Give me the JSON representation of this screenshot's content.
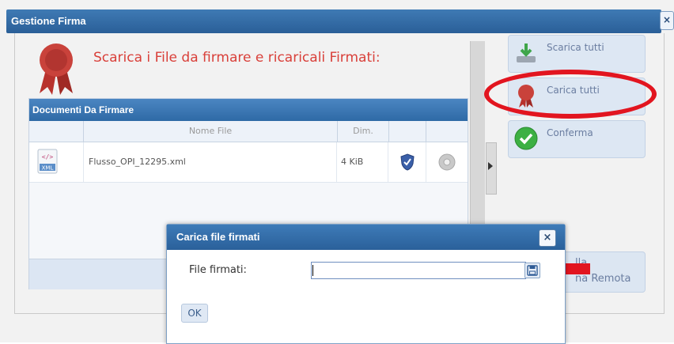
{
  "window": {
    "title": "Gestione Firma",
    "close_symbol": "×"
  },
  "heading": "Scarica i File da firmare e ricaricali Firmati:",
  "grid": {
    "title": "Documenti Da Firmare",
    "columns": [
      "",
      "Nome File",
      "Dim.",
      "",
      ""
    ],
    "rows": [
      {
        "icon": "xml-file-icon",
        "icon_text": "XML",
        "name": "Flusso_OPI_12295.xml",
        "size": "4 KiB"
      }
    ]
  },
  "actions": {
    "scarica_tutti": "Scarica tutti",
    "carica_tutti": "Carica tutti",
    "conferma": "Conferma",
    "partial_line1": "lla",
    "partial_line2": "na Remota"
  },
  "dialog": {
    "title": "Carica file firmati",
    "close_symbol": "×",
    "field_label": "File firmati:",
    "field_value": "",
    "ok_label": "OK"
  },
  "colors": {
    "accent": "#2e6aa6",
    "heading": "#d9403a",
    "highlight": "#e2151f"
  }
}
